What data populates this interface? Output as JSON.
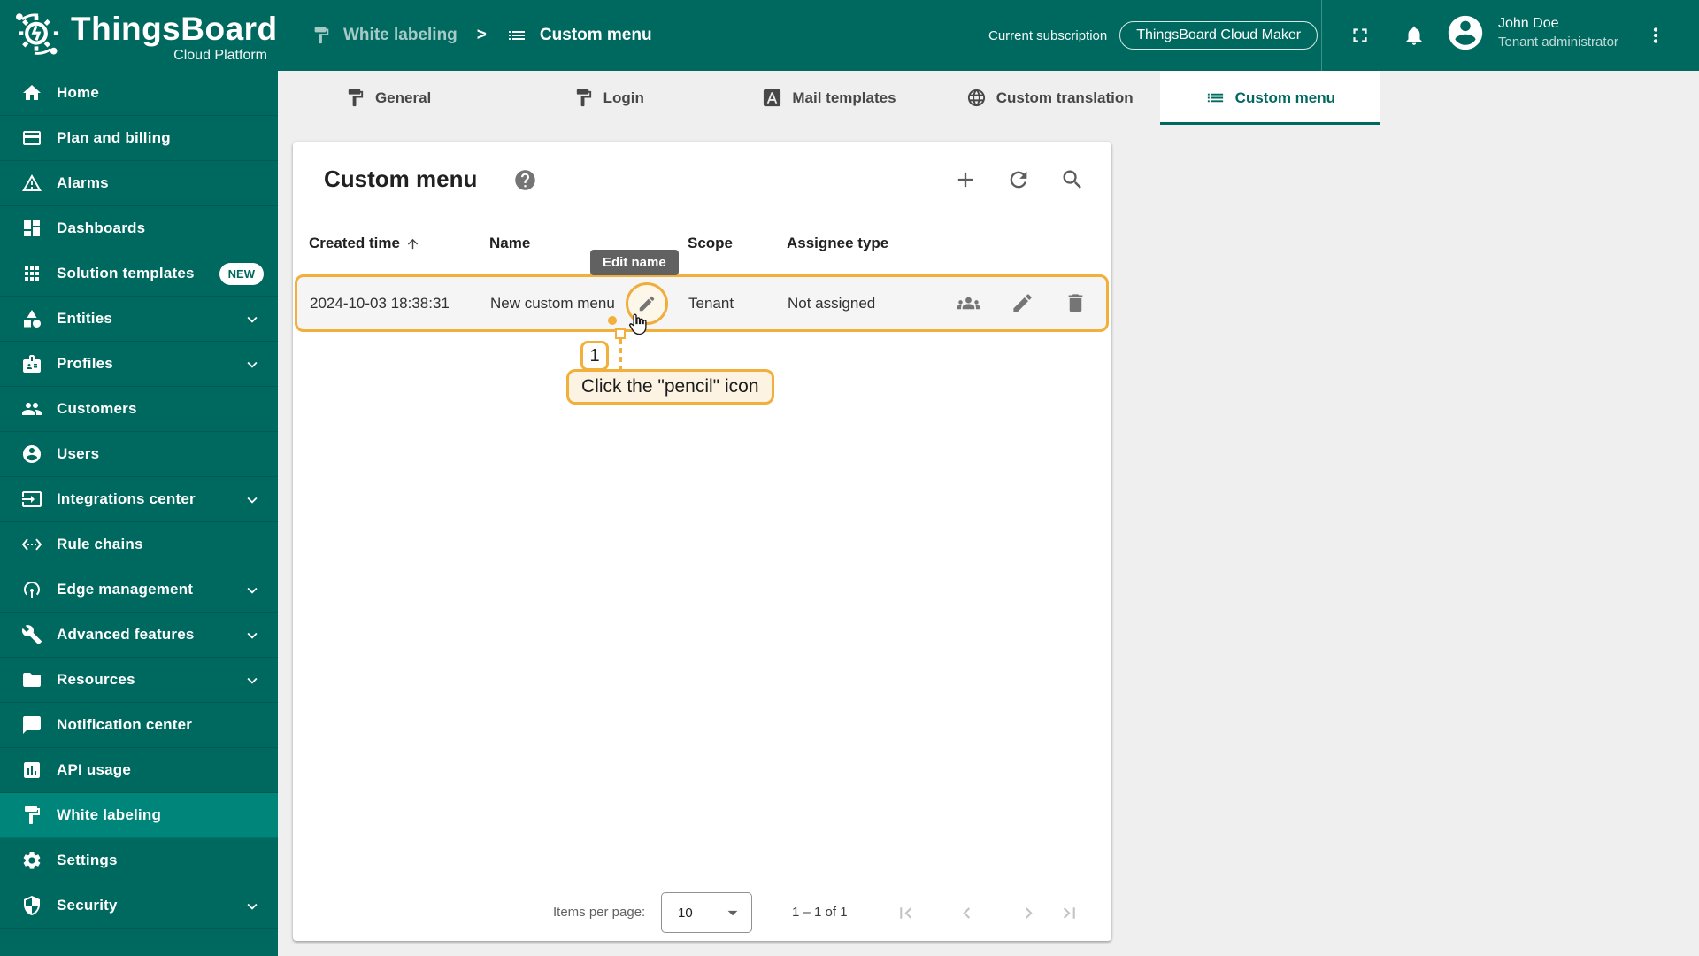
{
  "colors": {
    "primary_teal": "#00695f",
    "selected_teal": "#00857b",
    "annotation_yellow": "#f2af3b",
    "content_gray": "#efefef"
  },
  "brand": {
    "title": "ThingsBoard",
    "subtitle": "Cloud Platform"
  },
  "topbar": {
    "breadcrumb": {
      "parent": "White labeling",
      "separator": ">",
      "current": "Custom menu"
    },
    "subscription": {
      "label": "Current subscription",
      "plan": "ThingsBoard Cloud Maker"
    },
    "user": {
      "name": "John Doe",
      "role": "Tenant administrator"
    }
  },
  "sidebar": {
    "items": [
      {
        "label": "Home"
      },
      {
        "label": "Plan and billing"
      },
      {
        "label": "Alarms"
      },
      {
        "label": "Dashboards"
      },
      {
        "label": "Solution templates",
        "badge": "NEW"
      },
      {
        "label": "Entities"
      },
      {
        "label": "Profiles"
      },
      {
        "label": "Customers"
      },
      {
        "label": "Users"
      },
      {
        "label": "Integrations center"
      },
      {
        "label": "Rule chains"
      },
      {
        "label": "Edge management"
      },
      {
        "label": "Advanced features"
      },
      {
        "label": "Resources"
      },
      {
        "label": "Notification center"
      },
      {
        "label": "API usage"
      },
      {
        "label": "White labeling"
      },
      {
        "label": "Settings"
      },
      {
        "label": "Security"
      }
    ]
  },
  "tabs": [
    {
      "label": "General"
    },
    {
      "label": "Login"
    },
    {
      "label": "Mail templates"
    },
    {
      "label": "Custom translation"
    },
    {
      "label": "Custom menu"
    }
  ],
  "panel": {
    "title": "Custom menu",
    "columns": {
      "created_time": "Created time",
      "name": "Name",
      "scope": "Scope",
      "assignee_type": "Assignee type"
    },
    "row": {
      "created_time": "2024-10-03 18:38:31",
      "name": "New custom menu",
      "scope": "Tenant",
      "assignee_type": "Not assigned"
    },
    "pagination": {
      "items_per_page_label": "Items per page:",
      "page_size": "10",
      "range_label": "1 – 1 of 1"
    }
  },
  "annotations": {
    "tooltip": "Edit name",
    "step_number": "1",
    "instruction": "Click the \"pencil\" icon"
  }
}
